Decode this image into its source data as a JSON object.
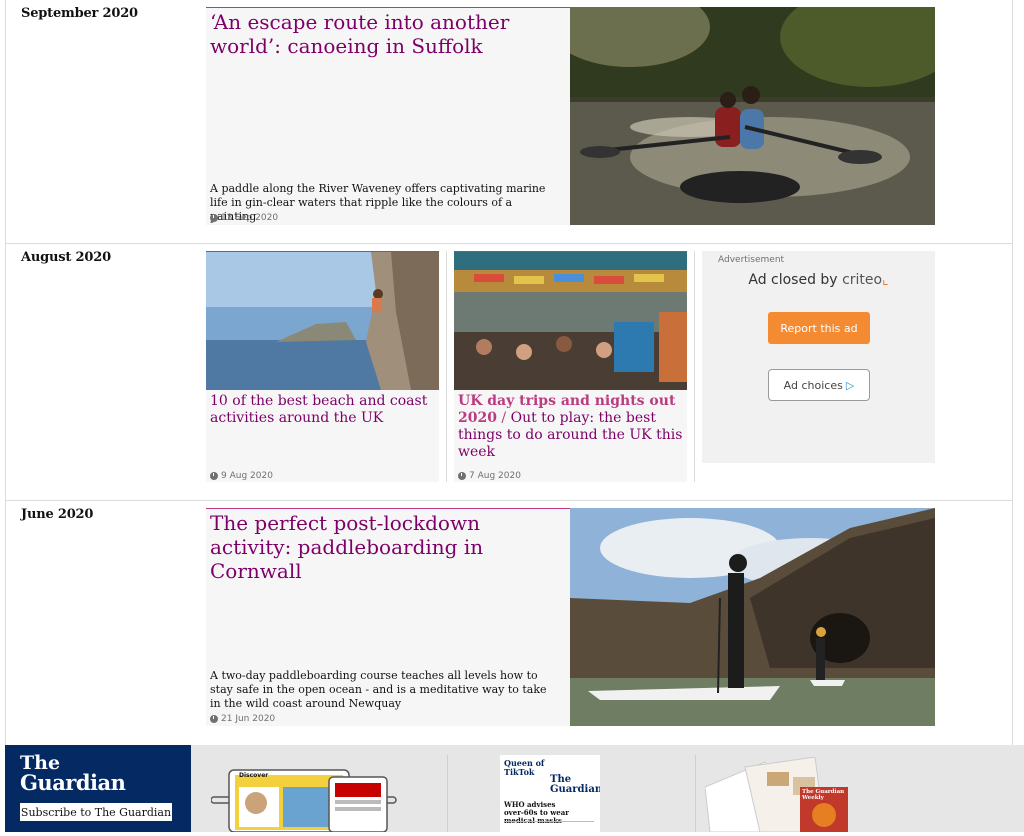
{
  "sections": [
    {
      "month": "September 2020",
      "card": {
        "headline": "‘An escape route into another world’: canoeing in Suffolk",
        "standfirst": "A paddle along the River Waveney offers captivating marine life in gin-clear waters that ripple like the colours of a painting",
        "date": "13 Sep 2020"
      }
    },
    {
      "month": "August 2020",
      "cards": [
        {
          "headline": "10 of the best beach and coast activities around the UK",
          "date": "9 Aug 2020"
        },
        {
          "kicker": "UK day trips and nights out 2020",
          "headline": "Out to play: the best things to do around the UK this week",
          "date": "7 Aug 2020"
        }
      ],
      "ad": {
        "label": "Advertisement",
        "closed_text": "Ad closed by",
        "closed_brand": "criteo",
        "report_button": "Report this ad",
        "choices_button": "Ad choices"
      }
    },
    {
      "month": "June 2020",
      "card": {
        "headline": "The perfect post-lockdown activity: paddleboarding in Cornwall",
        "standfirst": "A two-day paddleboarding course teaches all levels how to stay safe in the open ocean - and is a meditative way to take in the wild coast around Newquay",
        "date": "21 Jun 2020"
      }
    }
  ],
  "footer": {
    "logo_line1": "The",
    "logo_line2": "Guardian",
    "subscribe_button": "Subscribe to The Guardian",
    "promo1_label": "Discover",
    "promo2_masthead": "The Guardian",
    "promo2_headline": "WHO advises over-60s to wear medical masks",
    "promo2_kicker": "Queen of TikTok",
    "promo3_masthead": "The Guardian Weekly"
  },
  "colors": {
    "headline": "#7d0068",
    "brand_blue": "#052962",
    "ad_button": "#f48a31"
  }
}
